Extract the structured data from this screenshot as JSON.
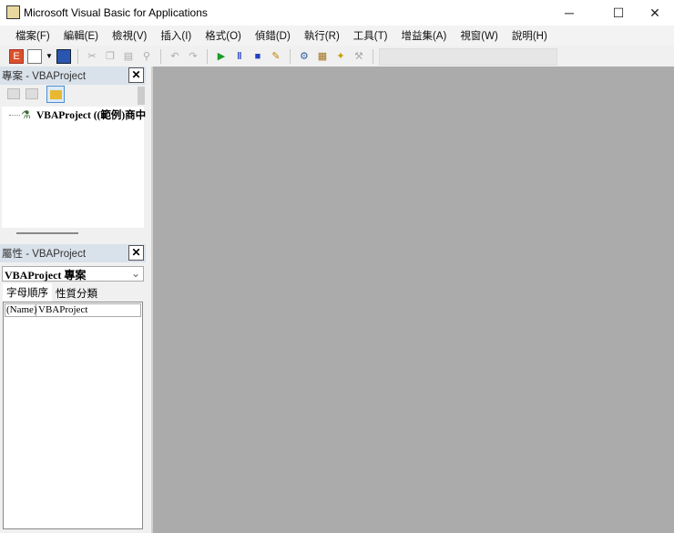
{
  "window": {
    "title": "Microsoft Visual Basic for Applications",
    "minimize": "─",
    "maximize": "☐",
    "close": "✕"
  },
  "menu": [
    "檔案(F)",
    "編輯(E)",
    "檢視(V)",
    "插入(I)",
    "格式(O)",
    "偵錯(D)",
    "執行(R)",
    "工具(T)",
    "增益集(A)",
    "視窗(W)",
    "說明(H)"
  ],
  "project_pane": {
    "title": "專案 - VBAProject",
    "close": "✕",
    "tree_item": "VBAProject ((範例)商中"
  },
  "properties_pane": {
    "title": "屬性 - VBAProject",
    "close": "✕",
    "object_select": "VBAProject 專案",
    "tabs": [
      "字母順序",
      "性質分類"
    ],
    "rows": [
      {
        "name": "(Name)",
        "value": "VBAProject"
      }
    ]
  },
  "colors": {
    "mdi": "#ababab",
    "pane_title": "#d9e1ea"
  }
}
